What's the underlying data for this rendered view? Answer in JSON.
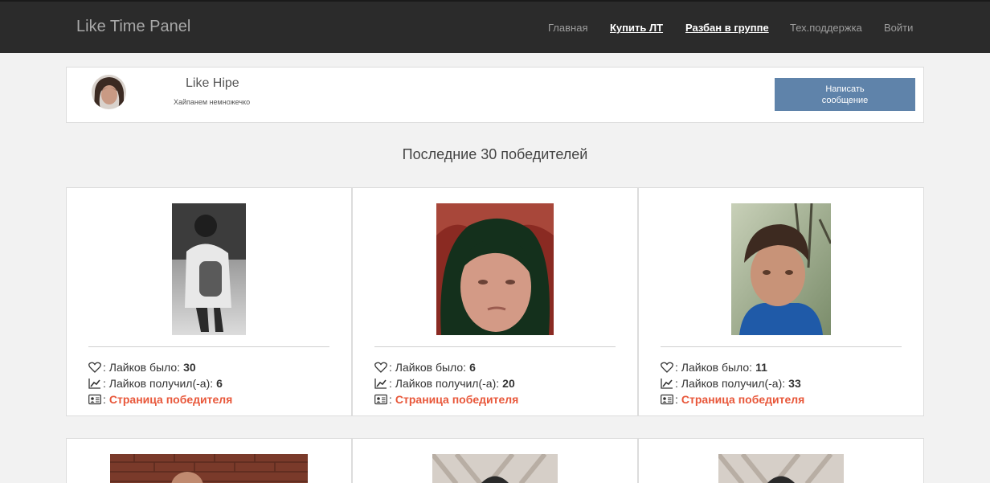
{
  "header": {
    "brand": "Like Time Panel",
    "nav": [
      {
        "label": "Главная",
        "bold": false
      },
      {
        "label": "Купить ЛТ",
        "bold": true
      },
      {
        "label": "Разбан в группе",
        "bold": true
      },
      {
        "label": "Тех.поддержка",
        "bold": false
      },
      {
        "label": "Войти",
        "bold": false
      }
    ]
  },
  "profile": {
    "name": "Like Hipe",
    "status": "Хайпанем немножечко",
    "message_button": "Написать сообщение"
  },
  "winners_title": "Последние 30 победителей",
  "labels": {
    "likes_before": ": Лайков было:",
    "likes_got": ": Лайков получил(-а):",
    "page_sep": ":",
    "page_link": "Страница победителя"
  },
  "icons": {
    "likes_before": "heart-icon",
    "likes_got": "chart-line-icon",
    "page": "id-card-icon"
  },
  "colors": {
    "navbar": "#2b2b2b",
    "button": "#5f83aa",
    "link": "#e8573a"
  },
  "winners": [
    {
      "likes_before": "30",
      "likes_got": "6"
    },
    {
      "likes_before": "6",
      "likes_got": "20"
    },
    {
      "likes_before": "11",
      "likes_got": "33"
    }
  ]
}
